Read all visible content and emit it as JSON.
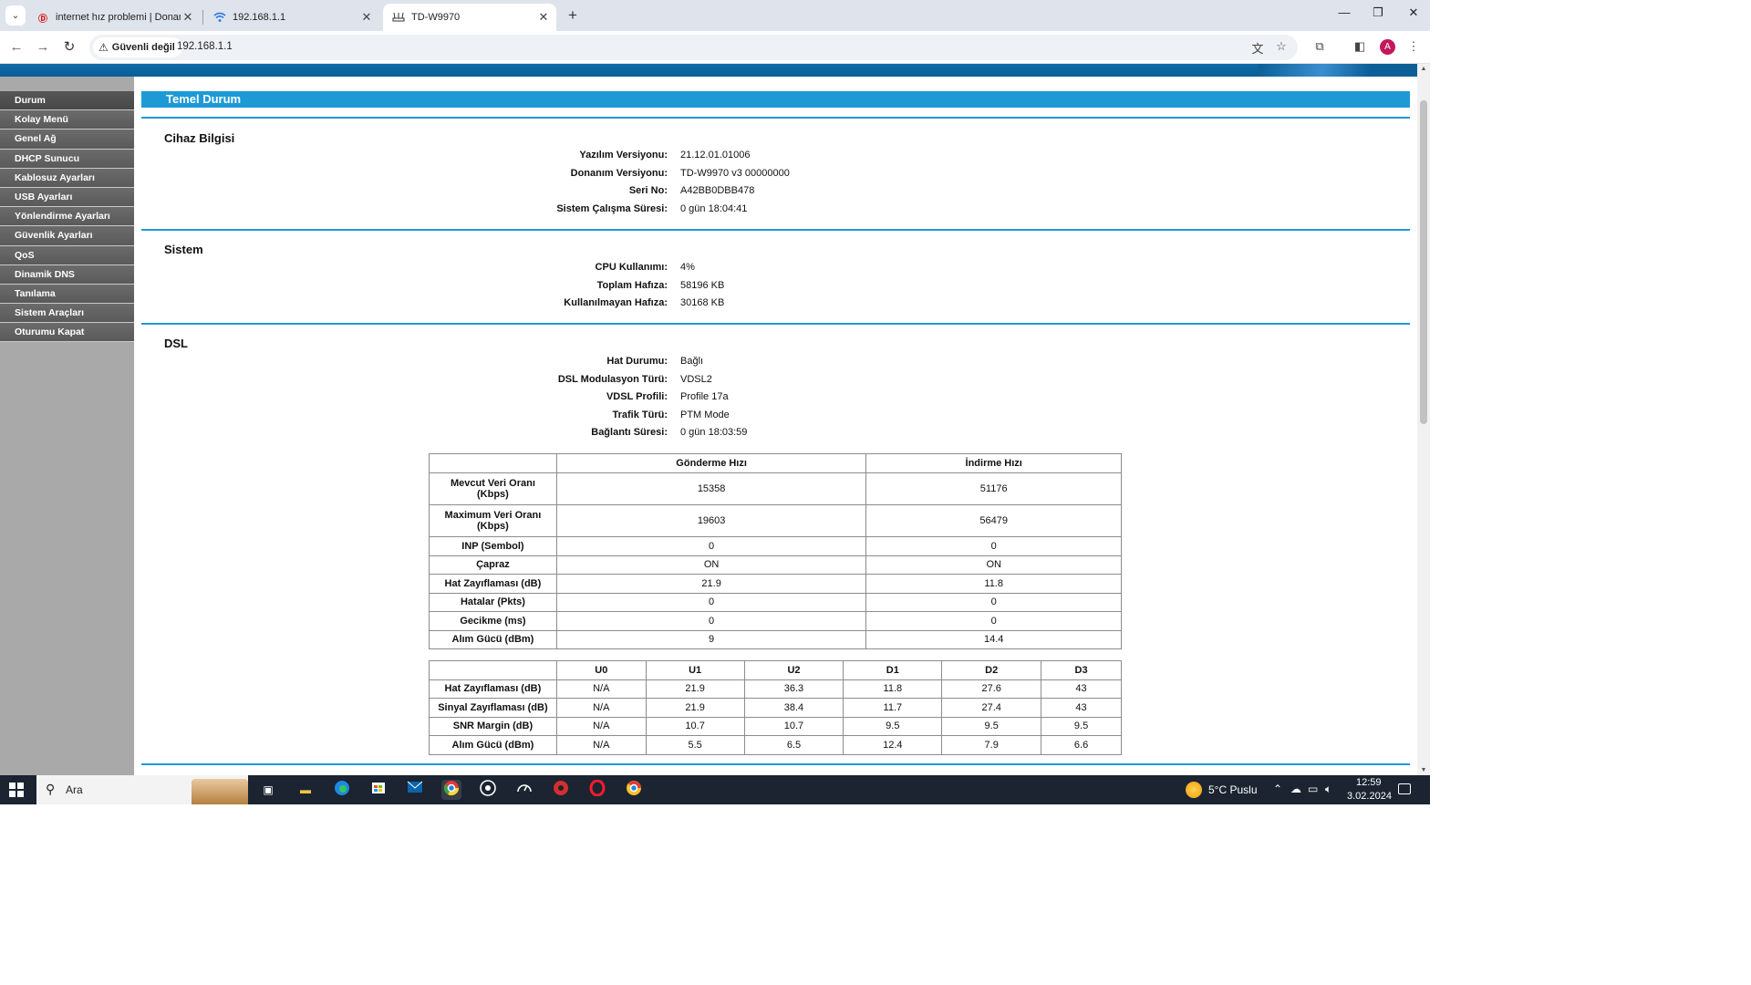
{
  "browser": {
    "tabs": [
      {
        "title": "internet hız problemi | Donanı",
        "icon": "donanimhaber-favicon"
      },
      {
        "title": "192.168.1.1",
        "icon": "wifi-icon"
      },
      {
        "title": "TD-W9970",
        "icon": "router-icon",
        "active": true
      }
    ],
    "security_label": "Güvenli değil",
    "url": "192.168.1.1",
    "profile_initial": "A"
  },
  "sidebar": {
    "items": [
      {
        "label": "Durum",
        "selected": true
      },
      {
        "label": "Kolay Menü"
      },
      {
        "label": "Genel Ağ"
      },
      {
        "label": "DHCP Sunucu"
      },
      {
        "label": "Kablosuz Ayarları"
      },
      {
        "label": "USB Ayarları"
      },
      {
        "label": "Yönlendirme Ayarları"
      },
      {
        "label": "Güvenlik Ayarları"
      },
      {
        "label": "QoS"
      },
      {
        "label": "Dinamik DNS"
      },
      {
        "label": "Tanılama"
      },
      {
        "label": "Sistem Araçları"
      },
      {
        "label": "Oturumu Kapat"
      }
    ]
  },
  "main": {
    "header": "Temel Durum",
    "device": {
      "title": "Cihaz Bilgisi",
      "rows": [
        {
          "label": "Yazılım Versiyonu:",
          "value": "21.12.01.01006"
        },
        {
          "label": "Donanım Versiyonu:",
          "value": "TD-W9970 v3 00000000"
        },
        {
          "label": "Seri No:",
          "value": "A42BB0DBB478"
        },
        {
          "label": "Sistem Çalışma Süresi:",
          "value": "0 gün 18:04:41"
        }
      ]
    },
    "system": {
      "title": "Sistem",
      "rows": [
        {
          "label": "CPU Kullanımı:",
          "value": "4%"
        },
        {
          "label": "Toplam Hafıza:",
          "value": "58196 KB"
        },
        {
          "label": "Kullanılmayan Hafıza:",
          "value": "30168 KB"
        }
      ]
    },
    "dsl": {
      "title": "DSL",
      "rows": [
        {
          "label": "Hat Durumu:",
          "value": "Bağlı"
        },
        {
          "label": "DSL Modulasyon Türü:",
          "value": "VDSL2"
        },
        {
          "label": "VDSL Profili:",
          "value": "Profile 17a"
        },
        {
          "label": "Trafik Türü:",
          "value": "PTM Mode"
        },
        {
          "label": "Bağlantı Süresi:",
          "value": "0 gün 18:03:59"
        }
      ],
      "rate_table": {
        "headers": [
          "",
          "Gönderme Hızı",
          "İndirme Hızı"
        ],
        "rows": [
          [
            "Mevcut Veri Oranı\n(Kbps)",
            "15358",
            "51176"
          ],
          [
            "Maximum Veri Oranı\n(Kbps)",
            "19603",
            "56479"
          ],
          [
            "INP (Sembol)",
            "0",
            "0"
          ],
          [
            "Çapraz",
            "ON",
            "ON"
          ],
          [
            "Hat Zayıflaması (dB)",
            "21.9",
            "11.8"
          ],
          [
            "Hatalar (Pkts)",
            "0",
            "0"
          ],
          [
            "Gecikme (ms)",
            "0",
            "0"
          ],
          [
            "Alım Gücü (dBm)",
            "9",
            "14.4"
          ]
        ]
      },
      "band_table": {
        "headers": [
          "",
          "U0",
          "U1",
          "U2",
          "D1",
          "D2",
          "D3"
        ],
        "rows": [
          [
            "Hat Zayıflaması (dB)",
            "N/A",
            "21.9",
            "36.3",
            "11.8",
            "27.6",
            "43"
          ],
          [
            "Sinyal Zayıflaması (dB)",
            "N/A",
            "21.9",
            "38.4",
            "11.7",
            "27.4",
            "43"
          ],
          [
            "SNR Margin (dB)",
            "N/A",
            "10.7",
            "10.7",
            "9.5",
            "9.5",
            "9.5"
          ],
          [
            "Alım Gücü (dBm)",
            "N/A",
            "5.5",
            "6.5",
            "12.4",
            "7.9",
            "6.6"
          ]
        ]
      }
    }
  },
  "taskbar": {
    "search_placeholder": "Ara",
    "weather": "5°C  Puslu",
    "time": "12:59",
    "date": "3.02.2024"
  }
}
